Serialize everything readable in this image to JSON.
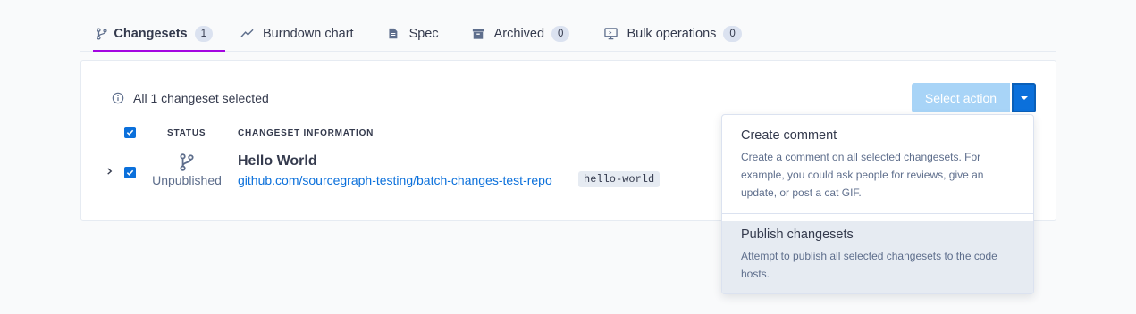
{
  "tabs": [
    {
      "label": "Changesets",
      "badge": "1",
      "icon": "branch-icon",
      "active": true
    },
    {
      "label": "Burndown chart",
      "icon": "chart-line-icon"
    },
    {
      "label": "Spec",
      "icon": "file-document-icon"
    },
    {
      "label": "Archived",
      "badge": "0",
      "icon": "archive-icon"
    },
    {
      "label": "Bulk operations",
      "badge": "0",
      "icon": "monitor-icon"
    }
  ],
  "selection": {
    "info": "All 1 changeset selected"
  },
  "action": {
    "select_label": "Select action"
  },
  "table": {
    "headers": {
      "status": "STATUS",
      "info": "CHANGESET INFORMATION"
    },
    "rows": [
      {
        "status": "Unpublished",
        "title": "Hello World",
        "repo": "github.com/sourcegraph-testing/batch-changes-test-repo",
        "branch": "hello-world"
      }
    ]
  },
  "menu": {
    "items": [
      {
        "title": "Create comment",
        "description": "Create a comment on all selected changesets. For example, you could ask people for reviews, give an update, or post a cat GIF."
      },
      {
        "title": "Publish changesets",
        "description": "Attempt to publish all selected changesets to the code hosts."
      }
    ]
  },
  "colors": {
    "accent": "#0b70db",
    "tab_underline": "#a305e1",
    "selected_bg": "#e6ebf2"
  }
}
